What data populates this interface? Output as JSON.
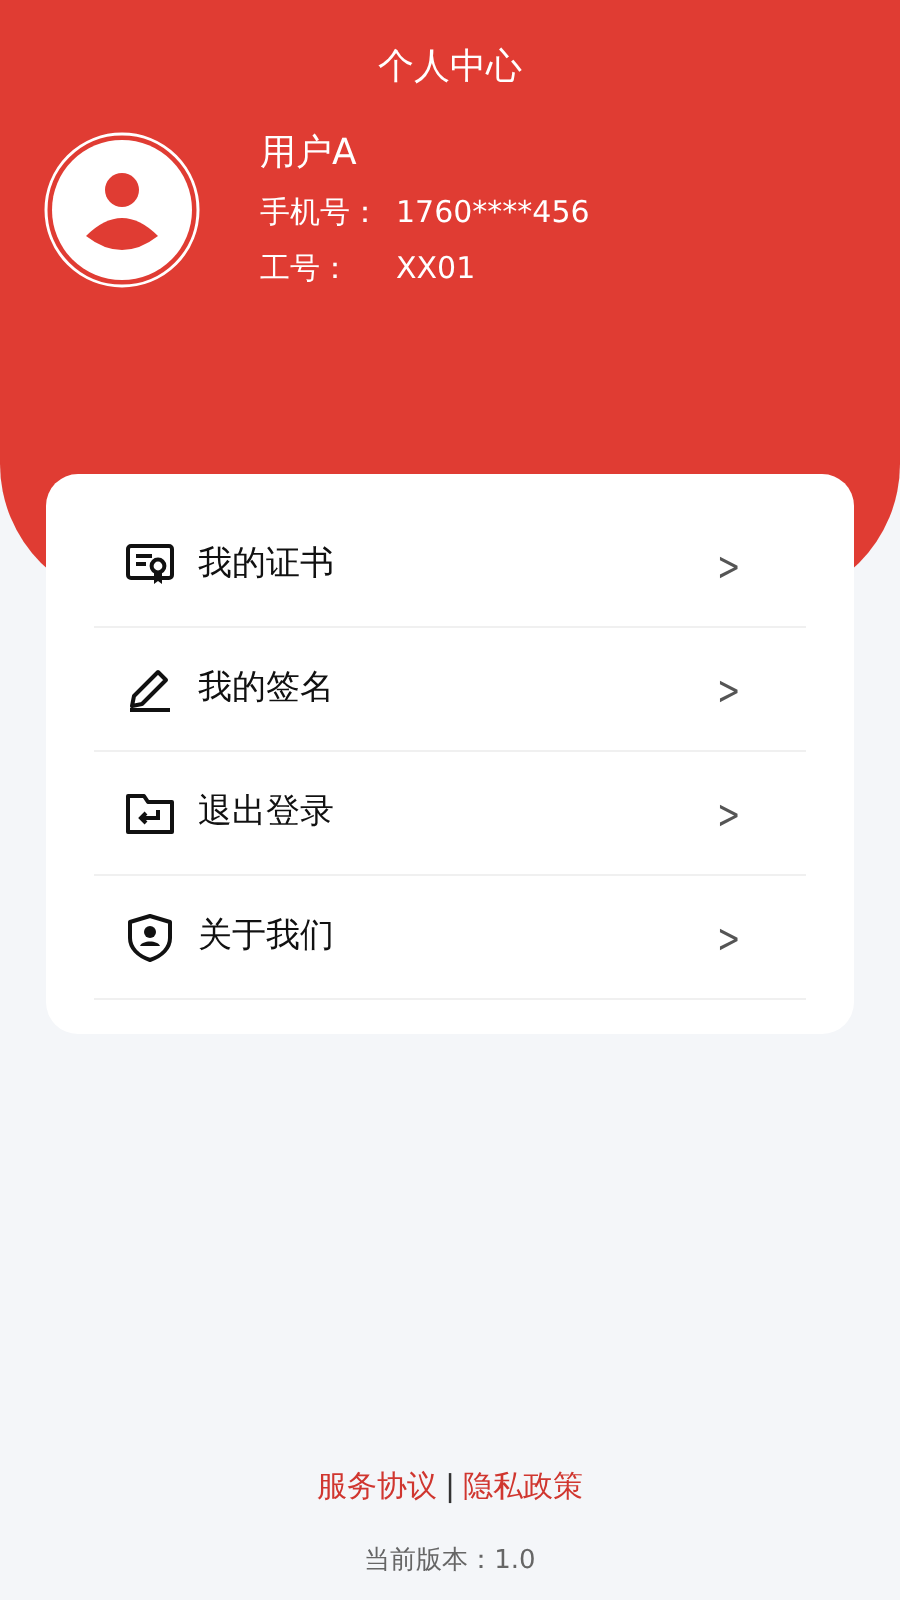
{
  "header": {
    "title": "个人中心"
  },
  "profile": {
    "name": "用户A",
    "phone_label": "手机号：",
    "phone": "1760****456",
    "id_label": "工号：",
    "id": "XX01"
  },
  "menu": [
    {
      "kind": "certificate",
      "label": "我的证书",
      "chevron": ">"
    },
    {
      "kind": "signature",
      "label": "我的签名",
      "chevron": ">"
    },
    {
      "kind": "logout",
      "label": "退出登录",
      "chevron": ">"
    },
    {
      "kind": "about",
      "label": "关于我们",
      "chevron": ">"
    }
  ],
  "footer": {
    "links": [
      "服务协议",
      "隐私政策"
    ],
    "separator": "|",
    "version": "当前版本：1.0"
  }
}
